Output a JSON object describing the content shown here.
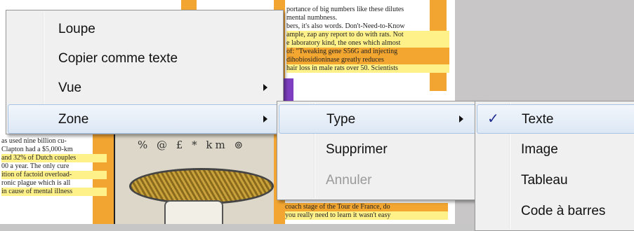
{
  "background_document": {
    "lines_top_right": [
      "portance of big numbers like these dilutes",
      "mental numbness.",
      "bers, it's also words. Don't-Need-to-Know",
      "ample, zap any report to do with rats. Not",
      "e laboratory kind, the ones which almost",
      "of: \"Tweaking gene S56G and injecting",
      "dihobiosidioninase greatly reduces",
      "hair loss in male rats over 50. Scientists"
    ],
    "lines_left": [
      "as used nine billion cu-",
      "Clapton had a $5,000-km",
      "and 32% of Dutch couples",
      "00 a year. The only cure",
      "ition of factoid overload-",
      "ronic plague which is all",
      "in cause of mental illness"
    ],
    "lines_bottom_right": [
      "coach stage of the Tour de France, do",
      "you really need to learn it wasn't easy"
    ],
    "illustration_glyphs": "%  @  £  *  km  ⊚"
  },
  "menu_main": {
    "items": [
      {
        "label": "Loupe"
      },
      {
        "label": "Copier comme texte"
      },
      {
        "label": "Vue"
      },
      {
        "label": "Zone"
      }
    ]
  },
  "menu_zone": {
    "items": [
      {
        "label": "Type"
      },
      {
        "label": "Supprimer"
      },
      {
        "label": "Annuler"
      }
    ]
  },
  "menu_type": {
    "items": [
      {
        "label": "Texte",
        "checked": true
      },
      {
        "label": "Image"
      },
      {
        "label": "Tableau"
      },
      {
        "label": "Code à barres"
      }
    ]
  },
  "icons": {
    "submenu": "chevron-right-icon",
    "checked": "check-mark-icon"
  },
  "colors": {
    "menu_bg": "#f0f0f0",
    "highlight_border": "#a8c2e4",
    "check": "#1e2c8e",
    "doc_orange": "#f3a731",
    "doc_purple": "#7d3fbf"
  }
}
